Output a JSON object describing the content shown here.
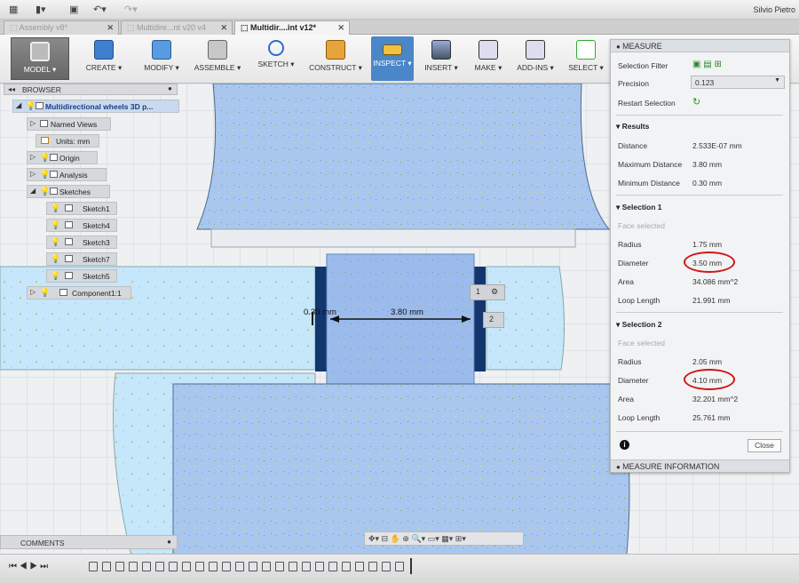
{
  "app": {
    "user": "Silvio Pietro"
  },
  "tabs": [
    {
      "label": "Assembly v8*"
    },
    {
      "label": "Multidire...nt v20 v4"
    },
    {
      "label": "Multidir....int v12*"
    }
  ],
  "toolbar": {
    "model": "MODEL ▾",
    "create": "CREATE ▾",
    "modify": "MODIFY ▾",
    "assemble": "ASSEMBLE ▾",
    "sketch": "SKETCH ▾",
    "construct": "CONSTRUCT ▾",
    "inspect": "INSPECT ▾",
    "insert": "INSERT ▾",
    "make": "MAKE ▾",
    "addins": "ADD-INS ▾",
    "select": "SELECT ▾"
  },
  "browser": {
    "title": "BROWSER",
    "root": "Multidirectional wheels 3D p...",
    "items": [
      {
        "label": "Named Views"
      },
      {
        "label": "Units: mm"
      },
      {
        "label": "Origin"
      },
      {
        "label": "Analysis"
      },
      {
        "label": "Sketches"
      },
      {
        "label": "Sketch1"
      },
      {
        "label": "Sketch4"
      },
      {
        "label": "Sketch3"
      },
      {
        "label": "Sketch7"
      },
      {
        "label": "Sketch5"
      },
      {
        "label": "Component1:1"
      }
    ]
  },
  "canvas": {
    "dimension_main": "3.80 mm",
    "dimension_small": "0.30 mm",
    "marker_1": "1",
    "marker_2": "2"
  },
  "measure": {
    "title": "MEASURE",
    "selection_filter_label": "Selection Filter",
    "precision_label": "Precision",
    "precision_value": "0.123",
    "restart_label": "Restart Selection",
    "results_title": "Results",
    "results": [
      {
        "label": "Distance",
        "value": "2.533E-07 mm"
      },
      {
        "label": "Maximum Distance",
        "value": "3.80 mm"
      },
      {
        "label": "Minimum Distance",
        "value": "0.30 mm"
      }
    ],
    "selection1": {
      "title": "Selection 1",
      "status": "Face selected",
      "rows": [
        {
          "label": "Radius",
          "value": "1.75 mm"
        },
        {
          "label": "Diameter",
          "value": "3.50 mm"
        },
        {
          "label": "Area",
          "value": "34.086 mm^2"
        },
        {
          "label": "Loop Length",
          "value": "21.991 mm"
        }
      ]
    },
    "selection2": {
      "title": "Selection 2",
      "status": "Face selected",
      "rows": [
        {
          "label": "Radius",
          "value": "2.05 mm"
        },
        {
          "label": "Diameter",
          "value": "4.10 mm"
        },
        {
          "label": "Area",
          "value": "32.201 mm^2"
        },
        {
          "label": "Loop Length",
          "value": "25.761 mm"
        }
      ]
    },
    "close_label": "Close",
    "info_label": "MEASURE INFORMATION"
  },
  "comments": {
    "label": "COMMENTS"
  },
  "colors": {
    "accent": "#4a86c8",
    "highlight_circle": "#d01515",
    "face": "#a9c7ee"
  }
}
